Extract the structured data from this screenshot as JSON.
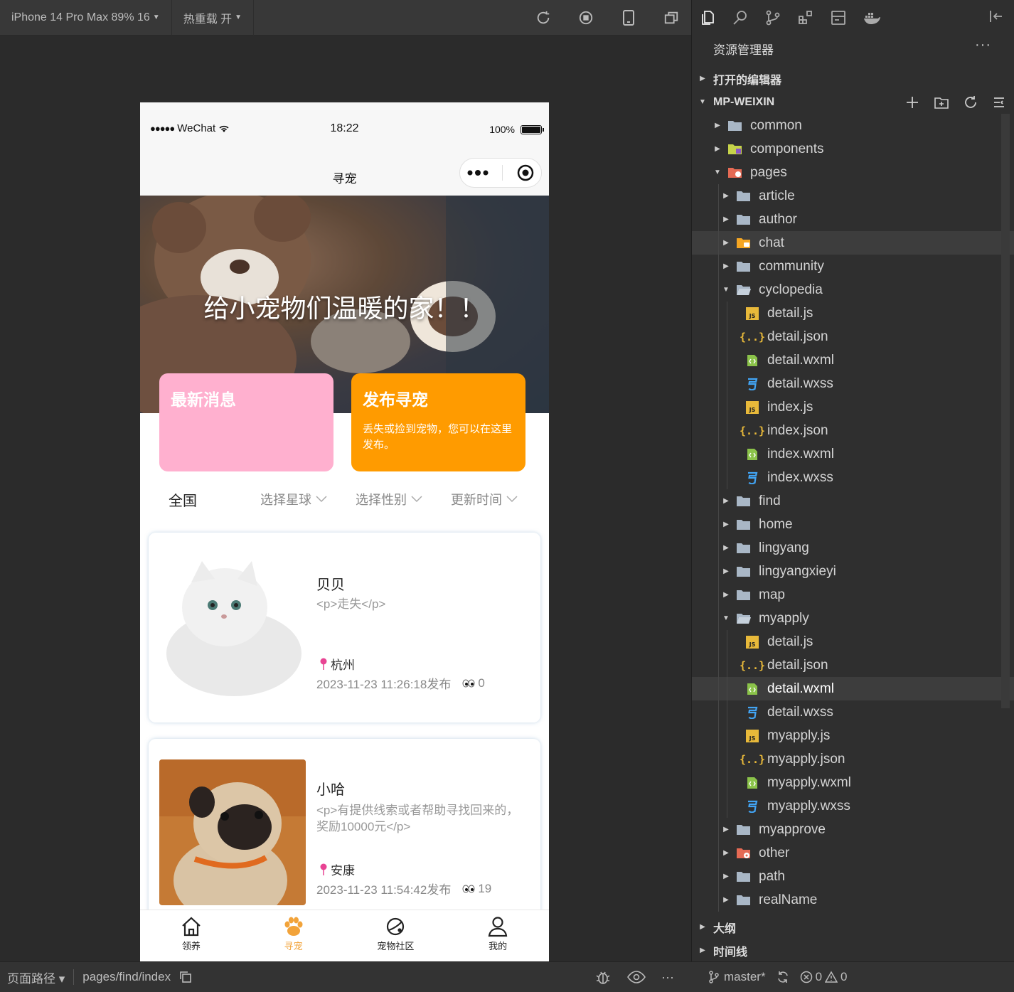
{
  "toolbar": {
    "device": "iPhone 14 Pro Max 89% 16",
    "hot_reload": "热重载 开"
  },
  "phone": {
    "status": {
      "carrier": "WeChat",
      "time": "18:22",
      "battery": "100%"
    },
    "nav_title": "寻宠",
    "banner_text": "给小宠物们温暖的家！！",
    "cards": [
      {
        "title": "最新消息",
        "desc": ""
      },
      {
        "title": "发布寻宠",
        "desc": "丢失或捡到宠物，您可以在这里发布。"
      }
    ],
    "filters": {
      "all": "全国",
      "options": [
        "选择星球",
        "选择性别",
        "更新时间"
      ]
    },
    "pets": [
      {
        "name": "贝贝",
        "desc": "<p>走失</p>",
        "location": "杭州",
        "time": "2023-11-23 11:26:18发布",
        "views": "0"
      },
      {
        "name": "小哈",
        "desc": "<p>有提供线索或者帮助寻找回来的，奖励10000元</p>",
        "location": "安康",
        "time": "2023-11-23 11:54:42发布",
        "views": "19"
      }
    ],
    "tabs": [
      {
        "label": "领养",
        "active": false
      },
      {
        "label": "寻宠",
        "active": true
      },
      {
        "label": "宠物社区",
        "active": false
      },
      {
        "label": "我的",
        "active": false
      }
    ]
  },
  "bottombar": {
    "path_label": "页面路径",
    "path": "pages/find/index",
    "branch": "master*",
    "errors": "0",
    "warnings": "0"
  },
  "explorer": {
    "title": "资源管理器",
    "open_editors": "打开的编辑器",
    "project": "MP-WEIXIN",
    "outline": "大纲",
    "timeline": "时间线",
    "tree": [
      {
        "label": "common",
        "type": "folder"
      },
      {
        "label": "components",
        "type": "folder-components"
      },
      {
        "label": "pages",
        "type": "folder-pages"
      },
      {
        "label": "article",
        "type": "folder"
      },
      {
        "label": "author",
        "type": "folder"
      },
      {
        "label": "chat",
        "type": "folder-chat"
      },
      {
        "label": "community",
        "type": "folder"
      },
      {
        "label": "cyclopedia",
        "type": "folder-open"
      },
      {
        "label": "detail.js",
        "type": "js"
      },
      {
        "label": "detail.json",
        "type": "json"
      },
      {
        "label": "detail.wxml",
        "type": "wxml"
      },
      {
        "label": "detail.wxss",
        "type": "wxss"
      },
      {
        "label": "index.js",
        "type": "js"
      },
      {
        "label": "index.json",
        "type": "json"
      },
      {
        "label": "index.wxml",
        "type": "wxml"
      },
      {
        "label": "index.wxss",
        "type": "wxss"
      },
      {
        "label": "find",
        "type": "folder"
      },
      {
        "label": "home",
        "type": "folder"
      },
      {
        "label": "lingyang",
        "type": "folder"
      },
      {
        "label": "lingyangxieyi",
        "type": "folder"
      },
      {
        "label": "map",
        "type": "folder"
      },
      {
        "label": "myapply",
        "type": "folder-open"
      },
      {
        "label": "detail.js",
        "type": "js"
      },
      {
        "label": "detail.json",
        "type": "json"
      },
      {
        "label": "detail.wxml",
        "type": "wxml"
      },
      {
        "label": "detail.wxss",
        "type": "wxss"
      },
      {
        "label": "myapply.js",
        "type": "js"
      },
      {
        "label": "myapply.json",
        "type": "json"
      },
      {
        "label": "myapply.wxml",
        "type": "wxml"
      },
      {
        "label": "myapply.wxss",
        "type": "wxss"
      },
      {
        "label": "myapprove",
        "type": "folder"
      },
      {
        "label": "other",
        "type": "folder-other"
      },
      {
        "label": "path",
        "type": "folder"
      },
      {
        "label": "realName",
        "type": "folder"
      }
    ]
  },
  "colors": {
    "accent_orange": "#ff9b00",
    "pink_card": "#ffb0cf",
    "tab_active": "#f2a33a",
    "js_icon": "#e8b93a",
    "json_icon": "#e8b93a",
    "wxml_icon": "#8bc34a",
    "wxss_icon": "#42a5f5",
    "folder_icon": "#a9b7c6"
  }
}
